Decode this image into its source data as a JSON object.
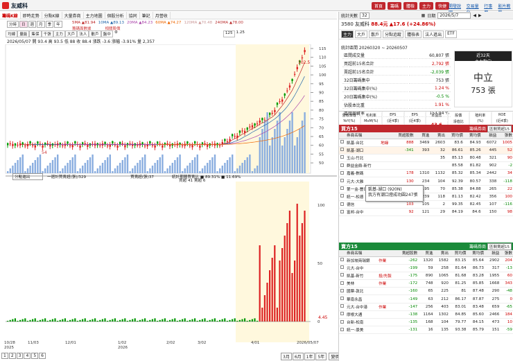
{
  "app": {
    "title": "友威科",
    "nav_buttons": [
      "首頁",
      "籌碼",
      "體檢",
      "主力",
      "快捷"
    ],
    "links": [
      "開發說明",
      "交易量化",
      "行事曆",
      "影片教學"
    ]
  },
  "tabs": [
    "籌碼K線",
    "即時走勢",
    "分點K線",
    "大量券商",
    "主力地圖",
    "個股分析",
    "協同",
    "筆記",
    "月營收"
  ],
  "toolbar": {
    "periods": [
      "分時",
      "日",
      "週",
      "月",
      "季",
      "年"
    ],
    "buttons": [
      "均線",
      "量能",
      "集保",
      "千張",
      "主力",
      "大戶",
      "法人",
      "散戶",
      "盤中"
    ],
    "range_label": "125",
    "zoom": "1.25"
  },
  "legend": {
    "ma5": "5MA ▲81.94",
    "ma10": "10MA ▲89.13",
    "ma20": "20MA ▲84.23",
    "ma60": "60MA ▲74.27",
    "ma120": "120MA ▲70.48",
    "ma240": "240MA ▲78.00",
    "extra1": "籌碼面數據",
    "extra2": "相關股價"
  },
  "quote_line": "2026/05/07 開 93.4 高 93.5 低 88 收 88.4 漲跌 -3.6 漲幅 -3.91% 量 2,357",
  "bottom_panel": {
    "select": "分點進出",
    "series": "一週計買賣超(張)/329",
    "buy_label": "買賣超(張)37",
    "price_label": "統計期間買賣比 ■ 89.31% ■ 11.69%",
    "broker_label": "買超 41 賣超 6"
  },
  "x_axis": [
    "10/28",
    "11/03",
    "12/01",
    "1/02",
    "2/02",
    "3/02",
    "4/01",
    "2026/05/07"
  ],
  "x_year": "2025",
  "x_year2": "2026",
  "y_axis_main": [
    "115",
    "110",
    "105",
    "100",
    "95",
    "90",
    "85",
    "80",
    "75",
    "70",
    "65",
    "60",
    "55",
    "50"
  ],
  "y_axis_vol": [
    "100",
    "50",
    "0"
  ],
  "price_tag": "102.5",
  "bottom_value": "4.45",
  "ma_label": "54",
  "page_nums": [
    "1",
    "2",
    "3",
    "4",
    "5",
    "6"
  ],
  "range_btns": [
    "3月",
    "6月",
    "1年",
    "5年"
  ],
  "sort_btn": "變價",
  "right": {
    "label_range": "統計天數",
    "range_val": "32",
    "label_date": "日期",
    "date_val": "2026/5/7",
    "stock_code": "3580 友威科",
    "stock_price": "88.4元",
    "stock_change": "▲17.6 (+24.86%)",
    "tabs": [
      "主力",
      "大戶",
      "散戶",
      "分點追蹤",
      "體檢表",
      "法人進出",
      "ETF"
    ],
    "period": "統計區間  20260320 ~ 20260507",
    "stats": [
      [
        "區間成交量",
        "60,807 張",
        ""
      ],
      [
        "買超前15名合計",
        "2,792 張",
        "r"
      ],
      [
        "賣超前15名合計",
        "-2,039 張",
        "g"
      ],
      [
        "32日籌碼集中",
        "753 張",
        ""
      ],
      [
        "32日籌碼集中(%)",
        "1.24 %",
        "r"
      ],
      [
        "20日籌碼集中(%)",
        "-0.5 %",
        "g"
      ],
      [
        "佔股本比重",
        "1.91 %",
        "r"
      ],
      [
        "區間周轉率",
        "153.94 %",
        ""
      ]
    ],
    "mainbox": {
      "h1": "近32天",
      "h2": "主力動向",
      "v1": "中立",
      "v2": "753 張"
    },
    "metrics": [
      [
        "營收年增",
        "YoY(%)",
        "-29.61",
        "g"
      ],
      [
        "毛利率",
        "MoM(%)",
        "87.17",
        "r"
      ],
      [
        "EPS",
        "(近4季)",
        "0.48",
        "r"
      ],
      [
        "EPS",
        "(近4季)",
        "1.94",
        "r"
      ],
      [
        "本益比",
        "",
        "43.6",
        "r"
      ],
      [
        "股價",
        "淨值比",
        "3.39",
        "r"
      ],
      [
        "殖利率",
        "(%)",
        "—",
        ""
      ],
      [
        "ROE",
        "(近4季)",
        "7.4",
        "r"
      ]
    ],
    "buy": {
      "title": "買方15",
      "hint": "籌碼券商",
      "sel": "區間買超15",
      "headers": [
        "券商名稱",
        "買超股數",
        "買進",
        "賣出",
        "買均價",
        "賣均價",
        "損益",
        "張數"
      ],
      "rows": [
        [
          "凱基-台北",
          "地緣",
          "888",
          "3469",
          "2603",
          "83.6",
          "84.93",
          "6072",
          "1005"
        ],
        [
          "凱基-湖口",
          "",
          "-341",
          "393",
          "32",
          "86.61",
          "85.26",
          "445",
          "52"
        ],
        [
          "玉山-竹北",
          "",
          "",
          "",
          "35",
          "85.13",
          "80.48",
          "321",
          "90"
        ],
        [
          "群益金鼎-新竹",
          "",
          "",
          "",
          "",
          "85.58",
          "81.82",
          "902",
          "-2"
        ],
        [
          "嘉義-數碼",
          "",
          "178",
          "1310",
          "1132",
          "85.32",
          "85.34",
          "2442",
          "34"
        ],
        [
          "元大-大雅",
          "",
          "130",
          "234",
          "104",
          "92.39",
          "80.57",
          "338",
          "-118"
        ],
        [
          "第一金-豐日",
          "",
          "125",
          "195",
          "70",
          "85.38",
          "84.88",
          "265",
          "22"
        ],
        [
          "統一-松德",
          "",
          "120",
          "239",
          "118",
          "81.13",
          "82.42",
          "356",
          "100"
        ],
        [
          "德信",
          "",
          "103",
          "105",
          "2",
          "99.35",
          "82.45",
          "107",
          "-116"
        ],
        [
          "富邦-台中",
          "",
          "92",
          "121",
          "29",
          "84.19",
          "84.6",
          "150",
          "98"
        ]
      ]
    },
    "sell": {
      "title": "賣方15",
      "hint": "籌碼券商",
      "sel": "區間賣超15",
      "headers": [
        "券商名稱",
        "賣超股數",
        "買進",
        "賣出",
        "買均價",
        "賣均價",
        "損益",
        "張數"
      ],
      "rows": [
        [
          "新加坡商瑞銀",
          "作業",
          "-262",
          "1320",
          "1582",
          "83.15",
          "85.64",
          "2902",
          "204"
        ],
        [
          "元大-台中",
          "",
          "-199",
          "59",
          "258",
          "81.64",
          "86.73",
          "317",
          "-13"
        ],
        [
          "凱基-新竹",
          "投/先製",
          "-175",
          "890",
          "1065",
          "81.68",
          "83.28",
          "1955",
          "60"
        ],
        [
          "美林",
          "作業",
          "-172",
          "748",
          "920",
          "81.25",
          "85.85",
          "1668",
          "343"
        ],
        [
          "國票-敦北",
          "",
          "-160",
          "65",
          "225",
          "81",
          "87.48",
          "290",
          "-48"
        ],
        [
          "華南永昌",
          "",
          "-149",
          "63",
          "212",
          "86.17",
          "87.87",
          "275",
          "0"
        ],
        [
          "元大-台中港",
          "作業",
          "-147",
          "256",
          "403",
          "83.01",
          "83.48",
          "659",
          "-65"
        ],
        [
          "摩根大通",
          "",
          "-138",
          "1164",
          "1302",
          "84.85",
          "85.60",
          "2466",
          "184"
        ],
        [
          "台新-松南",
          "",
          "-135",
          "168",
          "104",
          "79.77",
          "84.15",
          "473",
          "10"
        ],
        [
          "統一-景美",
          "",
          "-131",
          "16",
          "135",
          "93.38",
          "85.79",
          "151",
          "-59"
        ]
      ]
    },
    "tooltip": {
      "line1": "凱基-湖口 (920N)",
      "line2": "我方有潮口燈成功圓247張"
    }
  }
}
